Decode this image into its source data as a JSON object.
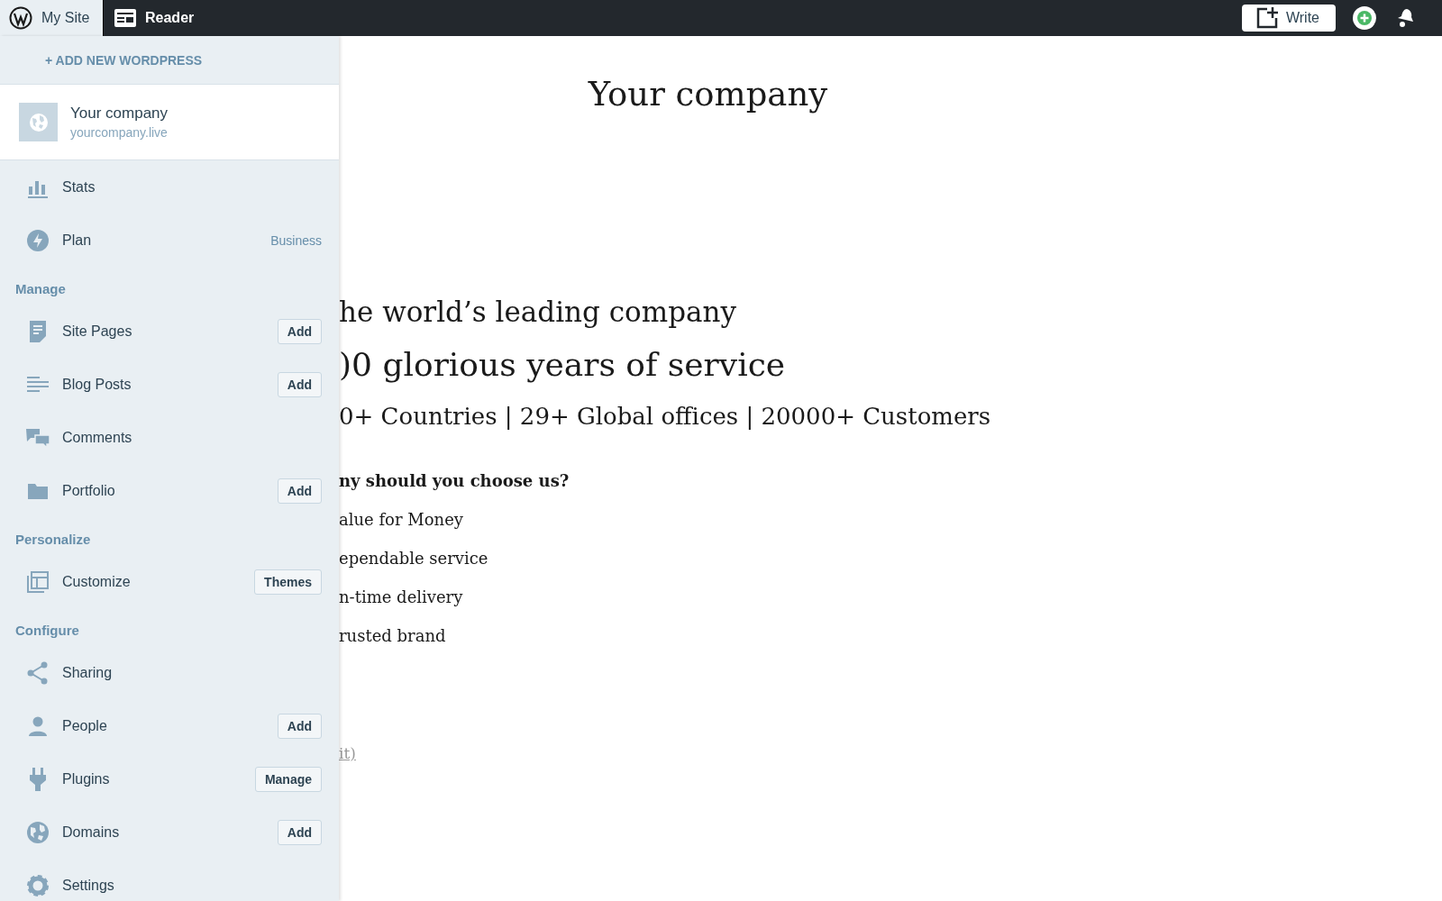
{
  "topbar": {
    "tabs": [
      {
        "label": "My Site",
        "selected": true
      },
      {
        "label": "Reader",
        "selected": false
      }
    ],
    "write_button": "Write"
  },
  "sidebar": {
    "add_new": "+ ADD NEW WORDPRESS",
    "site": {
      "name": "Your company",
      "url": "yourcompany.live"
    },
    "items": [
      {
        "kind": "item",
        "label": "Stats"
      },
      {
        "kind": "item",
        "label": "Plan",
        "badge": "Business"
      },
      {
        "kind": "heading",
        "label": "Manage"
      },
      {
        "kind": "item",
        "label": "Site Pages",
        "button": "Add"
      },
      {
        "kind": "item",
        "label": "Blog Posts",
        "button": "Add"
      },
      {
        "kind": "item",
        "label": "Comments"
      },
      {
        "kind": "item",
        "label": "Portfolio",
        "button": "Add"
      },
      {
        "kind": "heading",
        "label": "Personalize"
      },
      {
        "kind": "item",
        "label": "Customize",
        "button": "Themes"
      },
      {
        "kind": "heading",
        "label": "Configure"
      },
      {
        "kind": "item",
        "label": "Sharing"
      },
      {
        "kind": "item",
        "label": "People",
        "button": "Add"
      },
      {
        "kind": "item",
        "label": "Plugins",
        "button": "Manage"
      },
      {
        "kind": "item",
        "label": "Domains",
        "button": "Add"
      },
      {
        "kind": "item",
        "label": "Settings"
      }
    ]
  },
  "content": {
    "title": "Your company",
    "blocks": [
      {
        "kind": "h2",
        "text": "he world’s leading company"
      },
      {
        "kind": "h1",
        "text": ")0 glorious years of service"
      },
      {
        "kind": "h3",
        "text": "0+ Countries | 29+ Global offices | 20000+ Customers"
      },
      {
        "kind": "strong",
        "text": "ny should you choose us?"
      },
      {
        "kind": "p",
        "text": "alue for Money"
      },
      {
        "kind": "p",
        "text": "ependable service"
      },
      {
        "kind": "p",
        "text": "n-time delivery"
      },
      {
        "kind": "p",
        "text": "rusted brand"
      },
      {
        "kind": "link",
        "text": "it)"
      }
    ]
  }
}
